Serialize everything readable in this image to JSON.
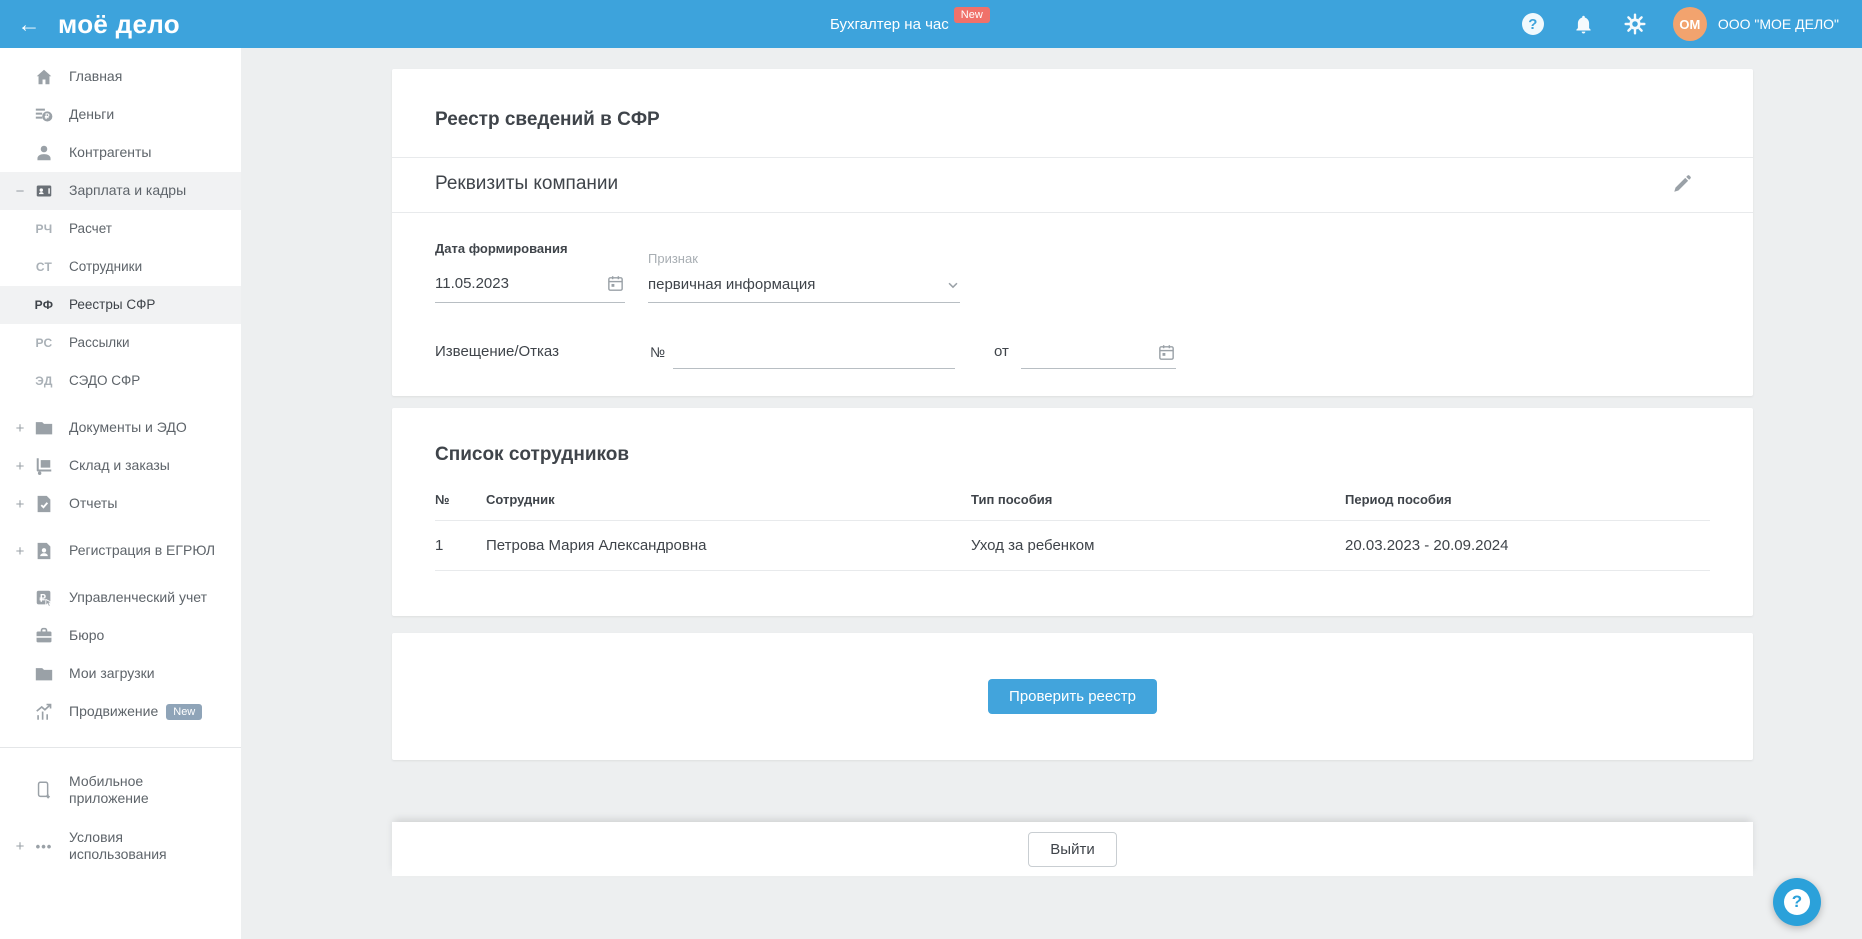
{
  "topbar": {
    "logo": "моё дело",
    "promo_link": "Бухгалтер на час",
    "promo_badge": "New",
    "account": {
      "initials": "ОМ",
      "company": "ООО \"МОЕ ДЕЛО\""
    }
  },
  "sidebar": {
    "items": [
      {
        "label": "Главная"
      },
      {
        "label": "Деньги"
      },
      {
        "label": "Контрагенты"
      },
      {
        "label": "Зарплата и кадры",
        "expander": "−"
      },
      {
        "label": "Расчет",
        "icon_text": "РЧ"
      },
      {
        "label": "Сотрудники",
        "icon_text": "СТ"
      },
      {
        "label": "Реестры СФР",
        "icon_text": "РФ"
      },
      {
        "label": "Рассылки",
        "icon_text": "РС"
      },
      {
        "label": "СЭДО СФР",
        "icon_text": "ЭД"
      },
      {
        "label": "Документы и ЭДО",
        "expander": "+"
      },
      {
        "label": "Склад и заказы",
        "expander": "+"
      },
      {
        "label": "Отчеты",
        "expander": "+"
      },
      {
        "label": "Регистрация в ЕГРЮЛ",
        "expander": "+"
      },
      {
        "label": "Управленческий учет"
      },
      {
        "label": "Бюро"
      },
      {
        "label": "Мои загрузки"
      },
      {
        "label": "Продвижение",
        "badge": "New"
      },
      {
        "label": "Мобильное приложение"
      },
      {
        "label": "Условия использования",
        "expander": "+",
        "icon_text": "•••"
      }
    ]
  },
  "main": {
    "title": "Реестр сведений в СФР",
    "requisites": {
      "title": "Реквизиты компании",
      "date_label": "Дата формирования",
      "date_value": "11.05.2023",
      "attr_label": "Признак",
      "attr_value": "первичная информация",
      "notice_label": "Извещение/Отказ",
      "number_label": "№",
      "from_label": "от"
    },
    "employees": {
      "title": "Список сотрудников",
      "columns": [
        "№",
        "Сотрудник",
        "Тип пособия",
        "Период пособия"
      ],
      "rows": [
        [
          "1",
          "Петрова Мария Александровна",
          "Уход за ребенком",
          "20.03.2023 - 20.09.2024"
        ]
      ]
    },
    "actions": {
      "check": "Проверить реестр",
      "exit": "Выйти"
    },
    "help": "?"
  },
  "colors": {
    "topbar": "#3da3dc",
    "accent": "#42a4dc",
    "badge_red": "#f0716a",
    "badge_gray": "#8fa4b8",
    "avatar": "#f2a36e"
  }
}
